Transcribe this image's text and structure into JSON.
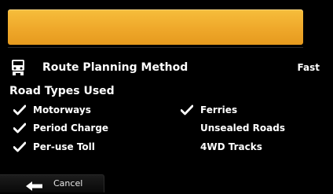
{
  "header": {
    "bar_color": "#efa82a"
  },
  "route_planning": {
    "icon": "vehicle-icon",
    "label": "Route Planning Method",
    "value": "Fast"
  },
  "road_types": {
    "title": "Road Types Used",
    "left": [
      {
        "label": "Motorways",
        "checked": true
      },
      {
        "label": "Period Charge",
        "checked": true
      },
      {
        "label": "Per-use Toll",
        "checked": true
      }
    ],
    "right": [
      {
        "label": "Ferries",
        "checked": true
      },
      {
        "label": "Unsealed Roads",
        "checked": false
      },
      {
        "label": "4WD Tracks",
        "checked": false
      }
    ]
  },
  "footer": {
    "cancel_label": "Cancel",
    "cancel_icon": "back-arrow-icon"
  }
}
